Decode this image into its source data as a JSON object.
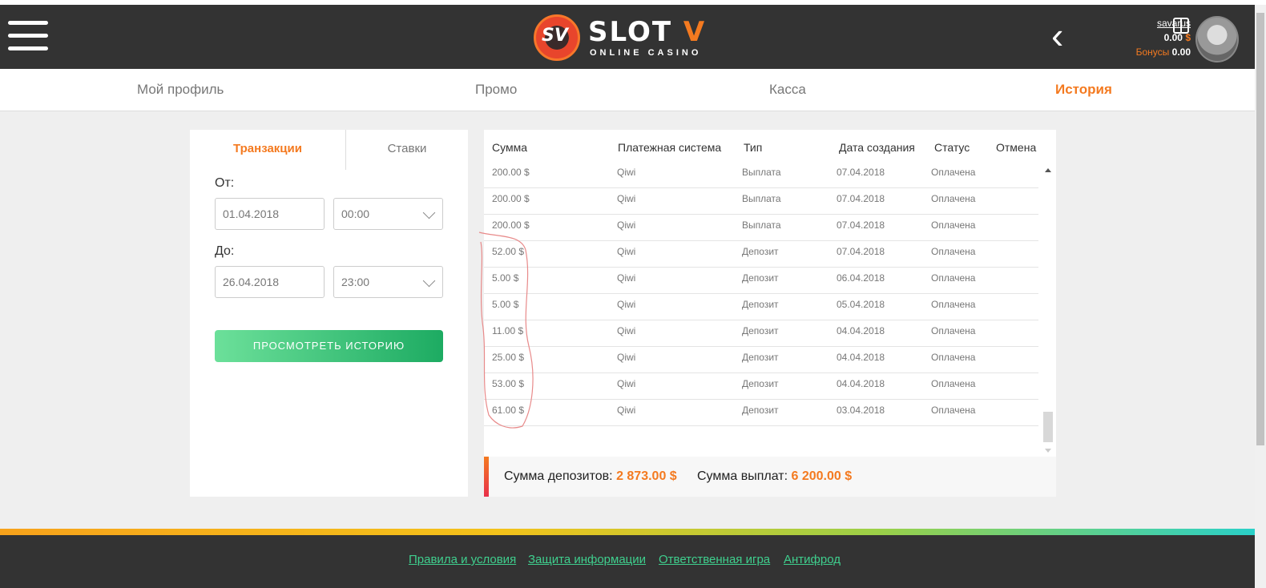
{
  "header": {
    "logo_badge": "SV",
    "logo_title_main": "SLOT ",
    "logo_title_accent": "V",
    "logo_subtitle": "ONLINE CASINO",
    "user": {
      "username": "savarus",
      "balance_value": "0.00",
      "balance_currency": "$",
      "bonus_label": "Бонусы",
      "bonus_value": "0.00"
    }
  },
  "nav": {
    "items": [
      {
        "label": "Мой профиль"
      },
      {
        "label": "Промо"
      },
      {
        "label": "Касса"
      },
      {
        "label": "История"
      }
    ],
    "active": "История"
  },
  "filter": {
    "tabs": [
      {
        "label": "Транзакции"
      },
      {
        "label": "Ставки"
      }
    ],
    "from_label": "От:",
    "from_date": "01.04.2018",
    "from_time": "00:00",
    "to_label": "До:",
    "to_date": "26.04.2018",
    "to_time": "23:00",
    "submit_label": "ПРОСМОТРЕТЬ ИСТОРИЮ"
  },
  "table": {
    "headers": [
      "Сумма",
      "Платежная система",
      "Тип",
      "Дата создания",
      "Статус",
      "Отмена"
    ],
    "rows": [
      [
        "200.00 $",
        "Qiwi",
        "Выплата",
        "07.04.2018",
        "Оплачена"
      ],
      [
        "200.00 $",
        "Qiwi",
        "Выплата",
        "07.04.2018",
        "Оплачена"
      ],
      [
        "200.00 $",
        "Qiwi",
        "Выплата",
        "07.04.2018",
        "Оплачена"
      ],
      [
        "52.00 $",
        "Qiwi",
        "Депозит",
        "07.04.2018",
        "Оплачена"
      ],
      [
        "5.00 $",
        "Qiwi",
        "Депозит",
        "06.04.2018",
        "Оплачена"
      ],
      [
        "5.00 $",
        "Qiwi",
        "Депозит",
        "05.04.2018",
        "Оплачена"
      ],
      [
        "11.00 $",
        "Qiwi",
        "Депозит",
        "04.04.2018",
        "Оплачена"
      ],
      [
        "25.00 $",
        "Qiwi",
        "Депозит",
        "04.04.2018",
        "Оплачена"
      ],
      [
        "53.00 $",
        "Qiwi",
        "Депозит",
        "04.04.2018",
        "Оплачена"
      ],
      [
        "61.00 $",
        "Qiwi",
        "Депозит",
        "03.04.2018",
        "Оплачена"
      ]
    ]
  },
  "totals": {
    "deposits_label": "Сумма депозитов:",
    "deposits_value": "2 873.00 $",
    "payouts_label": "Сумма выплат:",
    "payouts_value": "6 200.00 $"
  },
  "footer": {
    "links": [
      {
        "label": "Правила и условия"
      },
      {
        "label": "Защита информации"
      },
      {
        "label": "Ответственная игра"
      },
      {
        "label": "Антифрод"
      }
    ]
  },
  "colors": {
    "accent": "#f47a20",
    "link": "#3fcf8e",
    "header_bg": "#333333",
    "button_start": "#6ce09a",
    "button_end": "#1dab62"
  }
}
